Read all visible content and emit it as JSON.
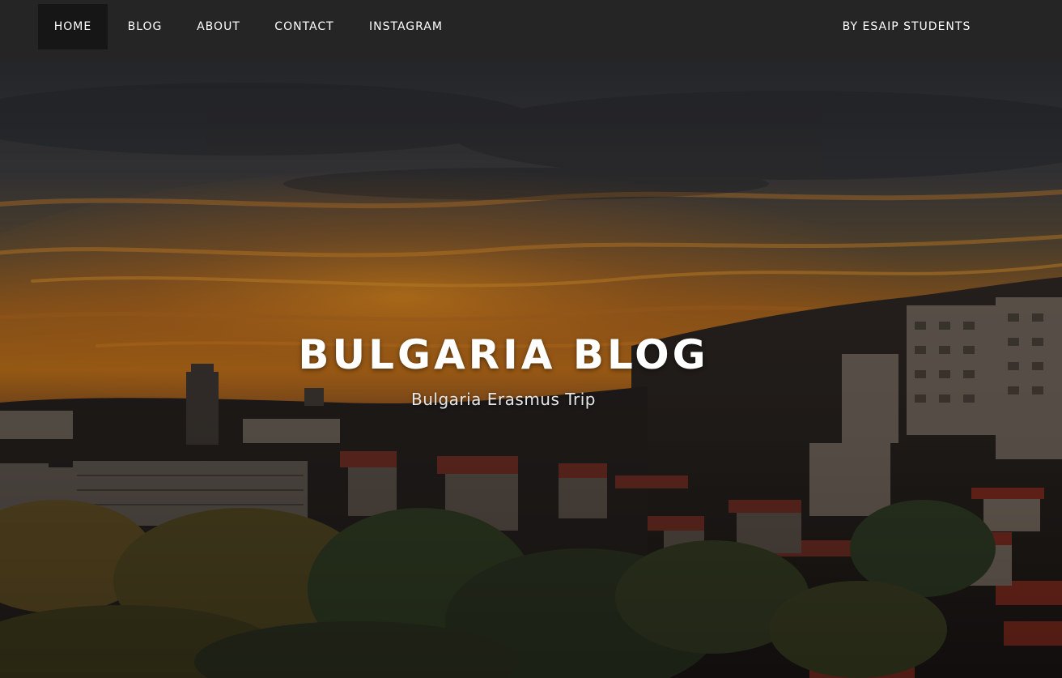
{
  "nav": {
    "items": [
      {
        "label": "HOME",
        "active": true
      },
      {
        "label": "BLOG",
        "active": false
      },
      {
        "label": "ABOUT",
        "active": false
      },
      {
        "label": "CONTACT",
        "active": false
      },
      {
        "label": "INSTAGRAM",
        "active": false
      }
    ],
    "byline": "BY ESAIP STUDENTS"
  },
  "hero": {
    "title": "BULGARIA BLOG",
    "subtitle": "Bulgaria Erasmus Trip",
    "background_scene": "sunset-over-hillside-town"
  },
  "colors": {
    "navbar_bg": "#252525",
    "nav_active_bg": "#161616",
    "nav_text": "#ffffff",
    "hero_title": "#ffffff",
    "sunset_orange": "#d07a18",
    "roof_red": "#7a2a1e"
  }
}
